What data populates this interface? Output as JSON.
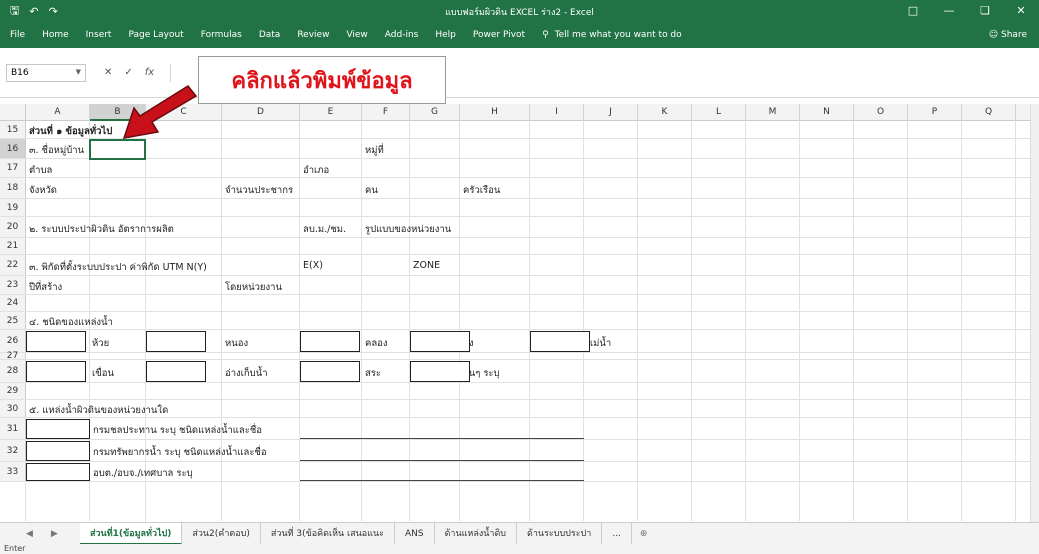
{
  "titlebar": {
    "title": "แบบฟอร์มผิวดิน EXCEL ร่าง2 - Excel",
    "save_icon": "save-icon",
    "undo_icon": "undo-icon",
    "redo_icon": "redo-icon"
  },
  "ribbon": {
    "tabs": [
      "File",
      "Home",
      "Insert",
      "Page Layout",
      "Formulas",
      "Data",
      "Review",
      "View",
      "Add-ins",
      "Help",
      "Power Pivot"
    ],
    "tell_me": "Tell me what you want to do",
    "share": "Share"
  },
  "formula_bar": {
    "name_box": "B16",
    "cancel": "✕",
    "enter": "✓",
    "fx": "fx"
  },
  "callout": {
    "text": "คลิกแล้วพิมพ์ข้อมูล",
    "color": "#e0121a"
  },
  "columns": [
    "A",
    "B",
    "C",
    "D",
    "E",
    "F",
    "G",
    "H",
    "I",
    "J",
    "K",
    "L",
    "M",
    "N",
    "O",
    "P",
    "Q",
    "R"
  ],
  "active_column": "B",
  "rows": {
    "r15": {
      "num": "15",
      "a": "ส่วนที่ ๑ ข้อมูลทั่วไป"
    },
    "r16": {
      "num": "16",
      "a": "๓. ชื่อหมู่บ้าน",
      "f": "หมู่ที่"
    },
    "r17": {
      "num": "17",
      "a": "ตำบล",
      "e": "อำเภอ"
    },
    "r18": {
      "num": "18",
      "a": "จังหวัด",
      "d": "จำนวนประชากร",
      "f": "คน",
      "h": "ครัวเรือน"
    },
    "r19": {
      "num": "19"
    },
    "r20": {
      "num": "20",
      "a": "๒. ระบบประปาผิวดิน อัตราการผลิต",
      "e": "ลบ.ม./ชม.",
      "f": "รูปแบบของหน่วยงาน"
    },
    "r21": {
      "num": "21"
    },
    "r22": {
      "num": "22",
      "a": "๓. พิกัดที่ตั้งระบบประปา  ค่าพิกัด UTM N(Y)",
      "e": "E(X)",
      "g": "ZONE"
    },
    "r23": {
      "num": "23",
      "a": "ปีที่สร้าง",
      "d": "โดยหน่วยงาน"
    },
    "r24": {
      "num": "24"
    },
    "r25": {
      "num": "25",
      "a": "๔. ชนิดของแหล่งน้ำ"
    },
    "r26": {
      "num": "26",
      "b": "ห้วย",
      "d": "หนอง",
      "f": "คลอง",
      "h": "บึง",
      "j": "แม่น้ำ"
    },
    "r27": {
      "num": "27"
    },
    "r28": {
      "num": "28",
      "b": "เขื่อน",
      "d": "อ่างเก็บน้ำ",
      "f": "สระ",
      "h": "อื่นๆ ระบุ"
    },
    "r29": {
      "num": "29"
    },
    "r30": {
      "num": "30",
      "a": "๕. แหล่งน้ำผิวดินของหน่วยงานใด"
    },
    "r31": {
      "num": "31",
      "b": "กรมชลประทาน ระบุ ชนิดแหล่งน้ำและชื่อ"
    },
    "r32": {
      "num": "32",
      "b": "กรมทรัพยากรน้ำ ระบุ ชนิดแหล่งน้ำและชื่อ"
    },
    "r33": {
      "num": "33",
      "b": "อบต./อบจ./เทศบาล ระบุ"
    }
  },
  "sheets": [
    "ส่วนที่1(ข้อมูลทั่วไป)",
    "ส่วน2(คำตอบ)",
    "ส่วนที่ 3(ข้อคิดเห็น เสนอแนะ",
    "ANS",
    "ด้านแหล่งน้ำดิบ",
    "ด้านระบบประปา",
    "..."
  ],
  "status": {
    "mode": "Enter"
  }
}
